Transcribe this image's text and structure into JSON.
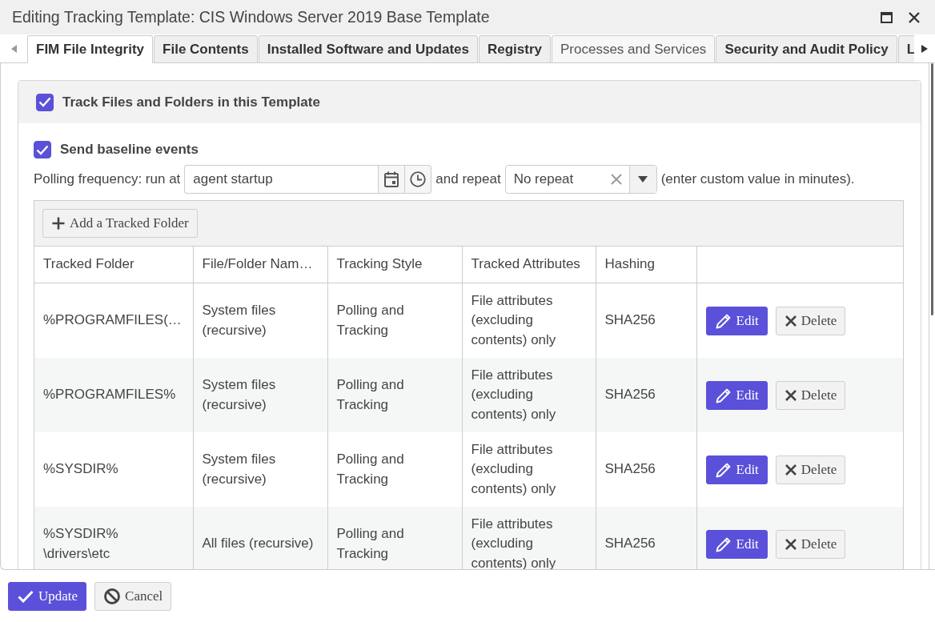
{
  "window": {
    "title": "Editing Tracking Template: CIS Windows Server 2019 Base Template"
  },
  "tabs": [
    {
      "label": "FIM File Integrity",
      "selected": true,
      "disabled": false
    },
    {
      "label": "File Contents",
      "selected": false,
      "disabled": false
    },
    {
      "label": "Installed Software and Updates",
      "selected": false,
      "disabled": false
    },
    {
      "label": "Registry",
      "selected": false,
      "disabled": false
    },
    {
      "label": "Processes and Services",
      "selected": false,
      "disabled": true
    },
    {
      "label": "Security and Audit Policy",
      "selected": false,
      "disabled": false
    },
    {
      "label": "L",
      "selected": false,
      "disabled": false
    }
  ],
  "panel": {
    "track": {
      "label": "Track Files and Folders in this Template",
      "checked": true
    },
    "baseline": {
      "label": "Send baseline events",
      "checked": true
    },
    "polling": {
      "run_at_label": "Polling frequency: run at",
      "run_at_value": "agent startup",
      "repeat_label": "and repeat",
      "repeat_value": "No repeat",
      "hint": "(enter custom value in minutes)."
    },
    "add_button": {
      "kind": "add",
      "label": "Add a Tracked Folder"
    },
    "table": {
      "columns": [
        "Tracked Folder",
        "File/Folder Nam…",
        "Tracking Style",
        "Tracked Attributes",
        "Hashing"
      ],
      "rows": [
        {
          "cells": [
            "%PROGRAMFILES(…",
            "System files (recursive)",
            "Polling and Tracking",
            "File attributes (excluding contents) only",
            "SHA256"
          ],
          "actions": [
            {
              "kind": "edit",
              "label": "Edit"
            },
            {
              "kind": "delete",
              "label": "Delete"
            }
          ]
        },
        {
          "cells": [
            "%PROGRAMFILES%",
            "System files (recursive)",
            "Polling and Tracking",
            "File attributes (excluding contents) only",
            "SHA256"
          ],
          "actions": [
            {
              "kind": "edit",
              "label": "Edit"
            },
            {
              "kind": "delete",
              "label": "Delete"
            }
          ]
        },
        {
          "cells": [
            "%SYSDIR%",
            "System files (recursive)",
            "Polling and Tracking",
            "File attributes (excluding contents) only",
            "SHA256"
          ],
          "actions": [
            {
              "kind": "edit",
              "label": "Edit"
            },
            {
              "kind": "delete",
              "label": "Delete"
            }
          ]
        },
        {
          "cells": [
            "%SYSDIR% \\drivers\\etc",
            "All files (recursive)",
            "Polling and Tracking",
            "File attributes (excluding contents) only",
            "SHA256"
          ],
          "actions": [
            {
              "kind": "edit",
              "label": "Edit"
            },
            {
              "kind": "delete",
              "label": "Delete"
            }
          ]
        }
      ]
    }
  },
  "buttons": [
    {
      "kind": "confirm",
      "label": "Update"
    },
    {
      "kind": "cancel",
      "label": "Cancel"
    }
  ]
}
